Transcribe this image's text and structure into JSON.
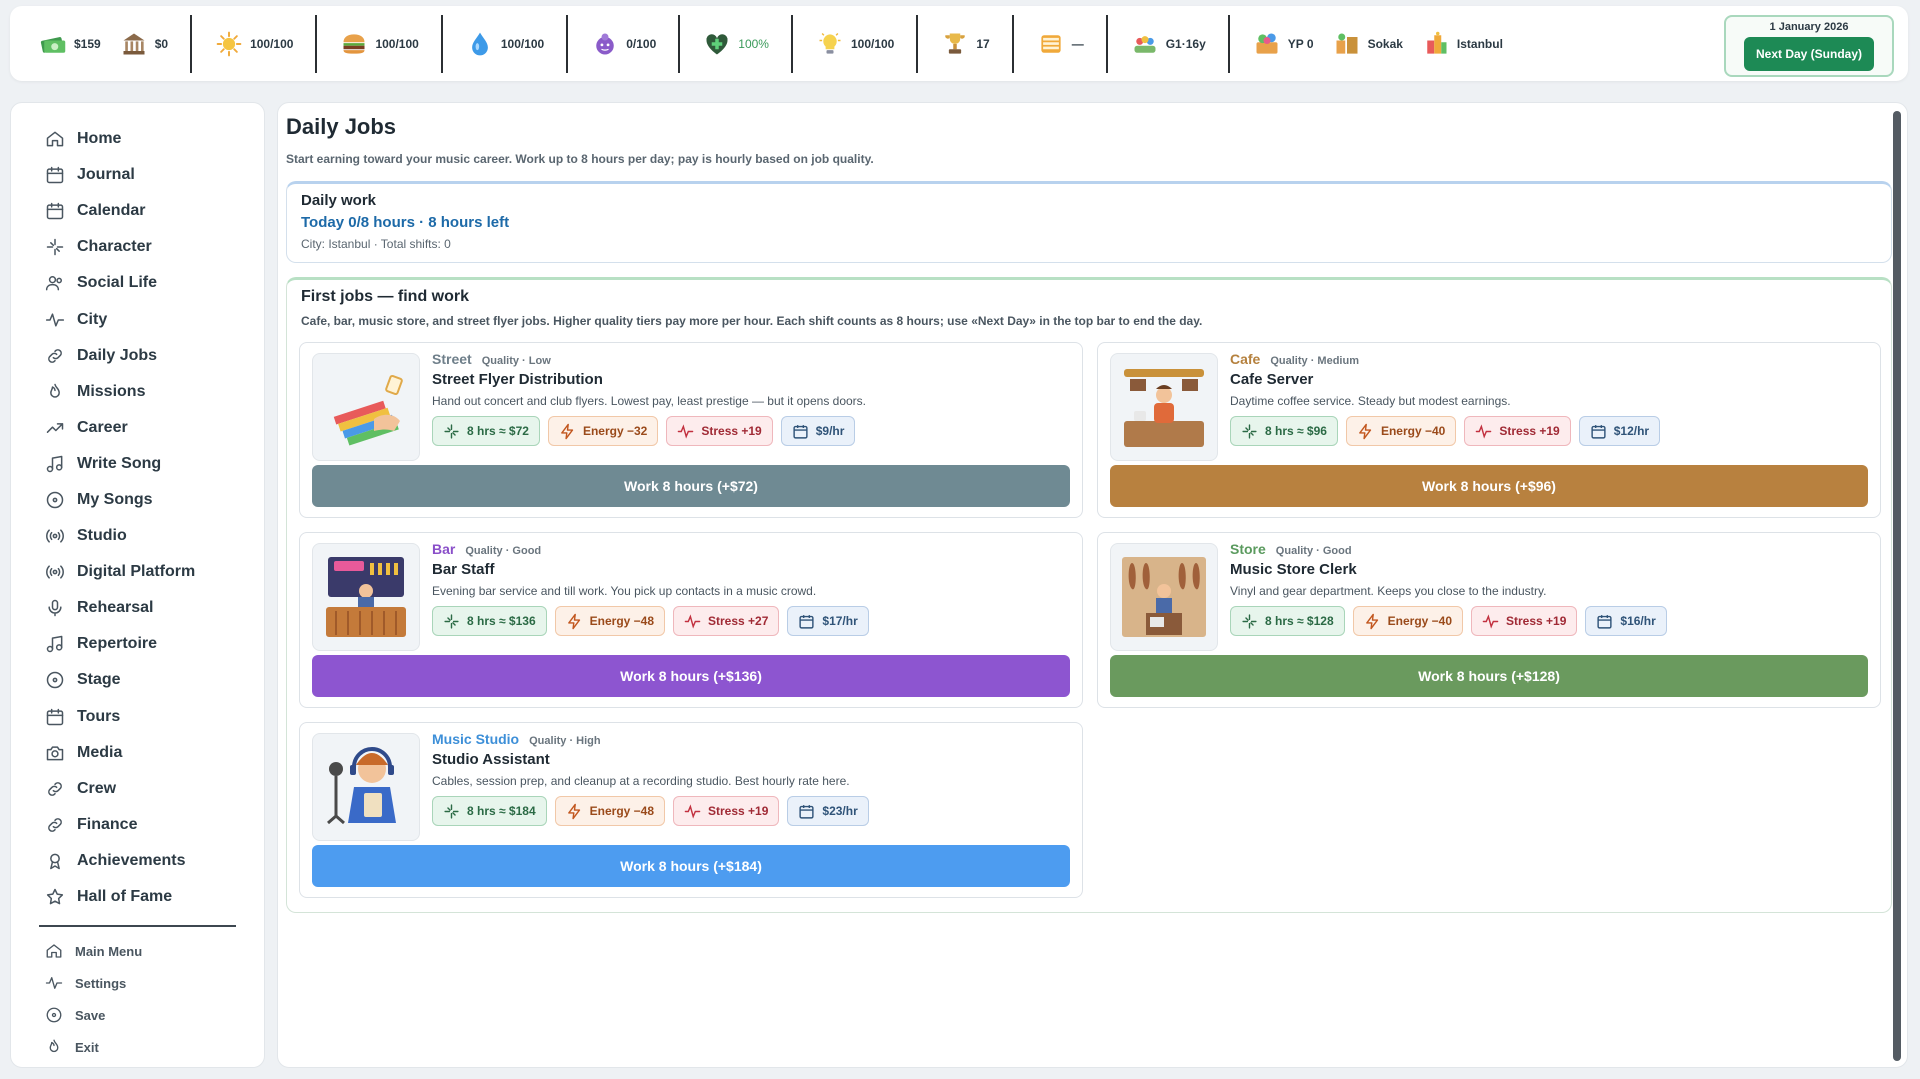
{
  "topbar": {
    "stats": [
      [
        {
          "name": "cash-icon",
          "value": "$159"
        },
        {
          "name": "bank-icon",
          "value": "$0"
        }
      ],
      [
        {
          "name": "energy-icon",
          "value": "100/100"
        }
      ],
      [
        {
          "name": "food-icon",
          "value": "100/100"
        }
      ],
      [
        {
          "name": "water-icon",
          "value": "100/100"
        }
      ],
      [
        {
          "name": "stress-icon",
          "value": "0/100"
        }
      ],
      [
        {
          "name": "health-icon",
          "value": "100%",
          "highlight": true
        }
      ],
      [
        {
          "name": "idea-icon",
          "value": "100/100"
        }
      ],
      [
        {
          "name": "fame-icon",
          "value": "17"
        }
      ],
      [
        {
          "name": "album-icon",
          "value": "—"
        }
      ],
      [
        {
          "name": "group-icon",
          "value": "G1·16y"
        }
      ],
      [
        {
          "name": "yp-icon",
          "value": "YP 0"
        },
        {
          "name": "street-icon",
          "value": "Sokak"
        },
        {
          "name": "city-icon",
          "value": "Istanbul"
        }
      ]
    ],
    "date": "1 January 2026",
    "next_day_label": "Next Day (Sunday)"
  },
  "sidebar": {
    "items": [
      {
        "label": "Home",
        "icon": "home-icon"
      },
      {
        "label": "Journal",
        "icon": "calendar-icon"
      },
      {
        "label": "Calendar",
        "icon": "calendar-icon"
      },
      {
        "label": "Character",
        "icon": "sparkle-icon"
      },
      {
        "label": "Social Life",
        "icon": "people-icon"
      },
      {
        "label": "City",
        "icon": "pulse-icon"
      },
      {
        "label": "Daily Jobs",
        "icon": "link-icon"
      },
      {
        "label": "Missions",
        "icon": "flame-icon"
      },
      {
        "label": "Career",
        "icon": "trend-icon"
      },
      {
        "label": "Write Song",
        "icon": "music-icon"
      },
      {
        "label": "My Songs",
        "icon": "disc-icon"
      },
      {
        "label": "Studio",
        "icon": "broadcast-icon"
      },
      {
        "label": "Digital Platform",
        "icon": "broadcast-icon"
      },
      {
        "label": "Rehearsal",
        "icon": "mic-icon"
      },
      {
        "label": "Repertoire",
        "icon": "music-icon"
      },
      {
        "label": "Stage",
        "icon": "disc-icon"
      },
      {
        "label": "Tours",
        "icon": "calendar-icon"
      },
      {
        "label": "Media",
        "icon": "camera-icon"
      },
      {
        "label": "Crew",
        "icon": "link-icon"
      },
      {
        "label": "Finance",
        "icon": "link-icon"
      },
      {
        "label": "Achievements",
        "icon": "award-icon"
      },
      {
        "label": "Hall of Fame",
        "icon": "star-icon"
      }
    ],
    "bottom": [
      {
        "label": "Main Menu",
        "icon": "home-icon"
      },
      {
        "label": "Settings",
        "icon": "pulse-icon"
      },
      {
        "label": "Save",
        "icon": "disc-icon"
      },
      {
        "label": "Exit",
        "icon": "flame-icon"
      }
    ]
  },
  "main": {
    "title": "Daily Jobs",
    "subtitle": "Start earning toward your music career. Work up to 8 hours per day; pay is hourly based on job quality.",
    "daily": {
      "title": "Daily work",
      "today": "Today 0/8 hours · 8 hours left",
      "meta": "City: Istanbul  · Total shifts: 0"
    },
    "jobs_section": {
      "title": "First jobs — find work",
      "desc": "Cafe, bar, music store, and street flyer jobs. Higher quality tiers pay more per hour. Each shift counts as 8 hours; use «Next Day» in the top bar to end the day."
    },
    "jobs": [
      {
        "category": "Street",
        "quality": "Quality · Low",
        "title": "Street Flyer Distribution",
        "desc": "Hand out concert and club flyers. Lowest pay, least prestige — but it opens doors.",
        "pay": "8 hrs ≈ $72",
        "energy": "Energy −32",
        "stress": "Stress +19",
        "rate": "$9/hr",
        "button": "Work 8 hours (+$72)",
        "cat_color": "#6f7f8a",
        "btn_color": "#6f8a93",
        "thumb": "flyer"
      },
      {
        "category": "Cafe",
        "quality": "Quality · Medium",
        "title": "Cafe Server",
        "desc": "Daytime coffee service. Steady but modest earnings.",
        "pay": "8 hrs ≈ $96",
        "energy": "Energy −40",
        "stress": "Stress +19",
        "rate": "$12/hr",
        "button": "Work 8 hours (+$96)",
        "cat_color": "#b5813e",
        "btn_color": "#b8813f",
        "thumb": "cafe"
      },
      {
        "category": "Bar",
        "quality": "Quality · Good",
        "title": "Bar Staff",
        "desc": "Evening bar service and till work. You pick up contacts in a music crowd.",
        "pay": "8 hrs ≈ $136",
        "energy": "Energy −48",
        "stress": "Stress +27",
        "rate": "$17/hr",
        "button": "Work 8 hours (+$136)",
        "cat_color": "#8a4fc9",
        "btn_color": "#8d55d0",
        "thumb": "bar"
      },
      {
        "category": "Store",
        "quality": "Quality · Good",
        "title": "Music Store Clerk",
        "desc": "Vinyl and gear department. Keeps you close to the industry.",
        "pay": "8 hrs ≈ $128",
        "energy": "Energy −40",
        "stress": "Stress +19",
        "rate": "$16/hr",
        "button": "Work 8 hours (+$128)",
        "cat_color": "#5a9a5e",
        "btn_color": "#6a9a5e",
        "thumb": "store"
      },
      {
        "category": "Music Studio",
        "quality": "Quality · High",
        "title": "Studio Assistant",
        "desc": "Cables, session prep, and cleanup at a recording studio. Best hourly rate here.",
        "pay": "8 hrs ≈ $184",
        "energy": "Energy −48",
        "stress": "Stress +19",
        "rate": "$23/hr",
        "button": "Work 8 hours (+$184)",
        "cat_color": "#3d8fd8",
        "btn_color": "#4d9cf0",
        "thumb": "studio"
      }
    ]
  }
}
